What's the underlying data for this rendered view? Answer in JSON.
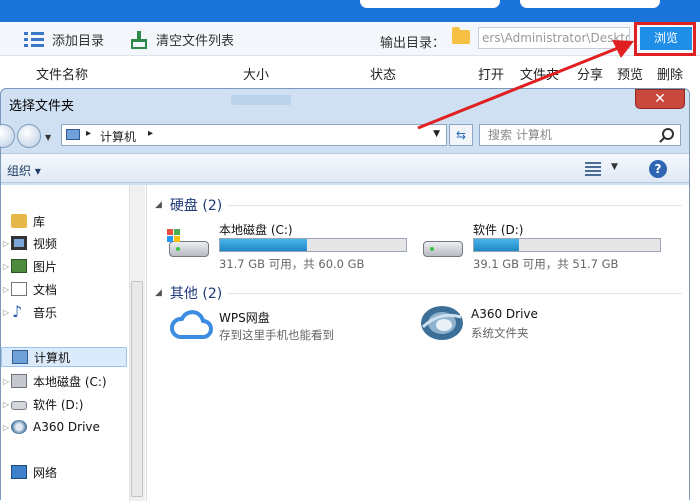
{
  "app": {
    "toolbar": {
      "add_dir_label": "添加目录",
      "clear_list_label": "清空文件列表",
      "output_dir_label": "输出目录：",
      "output_path": "ers\\Administrator\\Desktop",
      "browse_label": "浏览"
    },
    "columns": {
      "filename": "文件名称",
      "size": "大小",
      "status": "状态",
      "open": "打开",
      "folder": "文件夹",
      "share": "分享",
      "preview": "预览",
      "delete": "删除"
    }
  },
  "dialog": {
    "title": "选择文件夹",
    "close_glyph": "✕",
    "address": {
      "crumb": "计算机",
      "sep": "▸"
    },
    "search_placeholder": "搜索 计算机",
    "organize_label": "组织 ▾",
    "help_glyph": "?",
    "nav": [
      {
        "label": "库",
        "icon": "library-icon"
      },
      {
        "label": "视频",
        "icon": "video-icon"
      },
      {
        "label": "图片",
        "icon": "pictures-icon"
      },
      {
        "label": "文档",
        "icon": "documents-icon"
      },
      {
        "label": "音乐",
        "icon": "music-icon"
      },
      {
        "label": "计算机",
        "icon": "computer-icon",
        "selected": true
      },
      {
        "label": "本地磁盘 (C:)",
        "icon": "local-disk-icon"
      },
      {
        "label": "软件 (D:)",
        "icon": "disk-icon"
      },
      {
        "label": "A360 Drive",
        "icon": "a360-icon"
      },
      {
        "label": "网络",
        "icon": "network-icon"
      }
    ],
    "groups": {
      "hard_disks": "硬盘 (2)",
      "other": "其他 (2)"
    },
    "drives": [
      {
        "name": "本地磁盘 (C:)",
        "free_text": "31.7 GB 可用，共 60.0 GB",
        "used_fraction": 0.47
      },
      {
        "name": "软件 (D:)",
        "free_text": "39.1 GB 可用，共 51.7 GB",
        "used_fraction": 0.24
      }
    ],
    "others": [
      {
        "name": "WPS网盘",
        "subtitle": "存到这里手机也能看到"
      },
      {
        "name": "A360 Drive",
        "subtitle": "系统文件夹"
      }
    ]
  },
  "colors": {
    "app_blue": "#1a73d9",
    "browse_button": "#1e8ee8",
    "annotation_red": "#e02020",
    "drive_bar": "#2a9bd8"
  }
}
